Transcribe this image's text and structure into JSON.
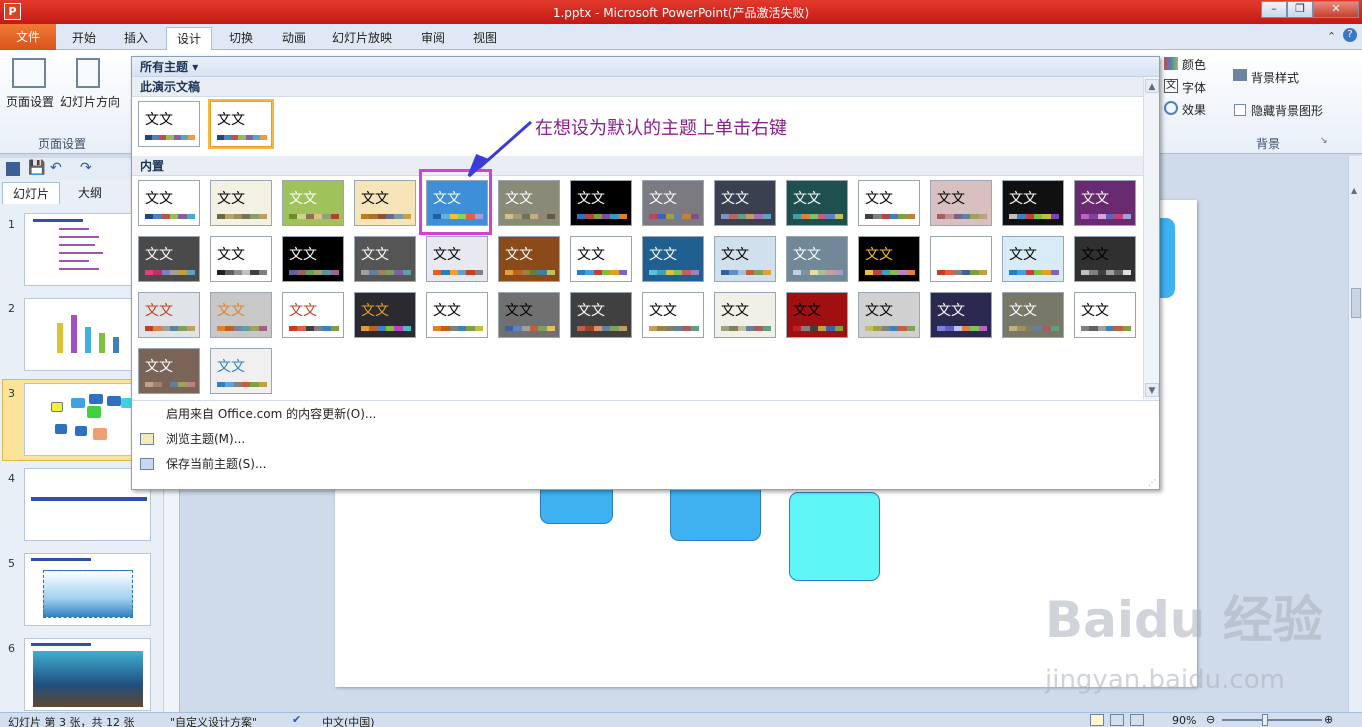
{
  "window": {
    "title": "1.pptx - Microsoft PowerPoint(产品激活失败)",
    "app_icon": "P"
  },
  "tabs": [
    "文件",
    "开始",
    "插入",
    "设计",
    "切换",
    "动画",
    "幻灯片放映",
    "审阅",
    "视图"
  ],
  "active_tab": "设计",
  "ribbon": {
    "page_setup": "页面设置",
    "slide_orientation": "幻灯片方向",
    "group_page_setup": "页面设置",
    "colors": "颜色",
    "fonts": "字体",
    "effects": "效果",
    "background_styles": "背景样式",
    "hide_background": "隐藏背景图形",
    "group_background": "背景"
  },
  "left_panel": {
    "tabs": [
      "幻灯片",
      "大纲"
    ],
    "slide_numbers": [
      "1",
      "2",
      "3",
      "4",
      "5",
      "6"
    ]
  },
  "gallery": {
    "header": "所有主题",
    "section_this": "此演示文稿",
    "section_builtin": "内置",
    "theme_text": "文文",
    "menu": [
      {
        "icon": "",
        "label": "启用来自 Office.com 的内容更新(O)..."
      },
      {
        "icon": "browse-icon",
        "label": "浏览主题(M)..."
      },
      {
        "icon": "save-icon",
        "label": "保存当前主题(S)..."
      }
    ],
    "this_themes": [
      {
        "bg": "#ffffff",
        "fg": "#000000",
        "sw": [
          "#1f497d",
          "#4f81bd",
          "#c0504d",
          "#9bbb59",
          "#8064a2",
          "#4bacc6",
          "#f79646"
        ]
      },
      {
        "bg": "#ffffff",
        "fg": "#000000",
        "sw": [
          "#1f497d",
          "#4f81bd",
          "#c0504d",
          "#9bbb59",
          "#8064a2",
          "#4bacc6",
          "#f79646"
        ],
        "selected": true
      }
    ],
    "builtin": [
      {
        "bg": "#ffffff",
        "fg": "#000",
        "sw": [
          "#1f497d",
          "#4f81bd",
          "#c0504d",
          "#9bbb59",
          "#8064a2",
          "#4bacc6"
        ]
      },
      {
        "bg": "#f3f0e4",
        "fg": "#000",
        "sw": [
          "#6b6b40",
          "#b5a46b",
          "#9c8e5f",
          "#7c6f5a",
          "#8a9b6d",
          "#c29f5f"
        ]
      },
      {
        "bg": "#9fc35a",
        "fg": "#ffffff",
        "sw": [
          "#6e8b2f",
          "#c5d88a",
          "#8d6f5a",
          "#e0c080",
          "#90a070",
          "#b04030"
        ]
      },
      {
        "bg": "#f7e4b8",
        "fg": "#000",
        "sw": [
          "#c07a20",
          "#a87030",
          "#905030",
          "#6a6a8a",
          "#7a9aa0",
          "#c5a050"
        ]
      },
      {
        "bg": "#3d8fd8",
        "fg": "#ffffff",
        "sw": [
          "#1f5fa0",
          "#60b0e0",
          "#f0c040",
          "#90d060",
          "#e06040",
          "#a0a0e0"
        ],
        "highlight": true
      },
      {
        "bg": "#8a8a78",
        "fg": "#ffffff",
        "sw": [
          "#d0c090",
          "#a0a070",
          "#707060",
          "#c0b080",
          "#908870",
          "#605848"
        ]
      },
      {
        "bg": "#000000",
        "fg": "#ffffff",
        "sw": [
          "#3070c0",
          "#c04040",
          "#80a030",
          "#8050a0",
          "#30a0c0",
          "#e08020"
        ]
      },
      {
        "bg": "#7a7a80",
        "fg": "#ffffff",
        "sw": [
          "#c04060",
          "#4060c0",
          "#a0a040",
          "#6080a0",
          "#c08040",
          "#805080"
        ]
      },
      {
        "bg": "#3a4050",
        "fg": "#ffffff",
        "sw": [
          "#8090c0",
          "#c06060",
          "#60a080",
          "#c0a060",
          "#a070b0",
          "#60a0c0"
        ]
      },
      {
        "bg": "#1e5050",
        "fg": "#ffffff",
        "sw": [
          "#40a0a0",
          "#e08040",
          "#80c060",
          "#c06080",
          "#6080c0",
          "#c0c060"
        ]
      },
      {
        "bg": "#ffffff",
        "fg": "#000",
        "sw": [
          "#404040",
          "#808080",
          "#c04040",
          "#4080c0",
          "#80a040",
          "#c08040"
        ]
      },
      {
        "bg": "#d8c0c0",
        "fg": "#000",
        "sw": [
          "#a06060",
          "#c09090",
          "#806080",
          "#6080a0",
          "#a0a060",
          "#c0a080"
        ]
      },
      {
        "bg": "#101010",
        "fg": "#ffffff",
        "sw": [
          "#c0c0c0",
          "#4080c0",
          "#c04040",
          "#80c040",
          "#c0c040",
          "#8040c0"
        ]
      },
      {
        "bg": "#6a2a70",
        "fg": "#ffffff",
        "sw": [
          "#c060c0",
          "#8040a0",
          "#e0a0e0",
          "#6060c0",
          "#c04080",
          "#a0a0e0"
        ]
      },
      {
        "bg": "#4a4a4a",
        "fg": "#ffffff",
        "sw": [
          "#e04080",
          "#c03060",
          "#8080c0",
          "#a0a0a0",
          "#c0a040",
          "#60a0c0"
        ]
      },
      {
        "bg": "#ffffff",
        "fg": "#000",
        "sw": [
          "#202020",
          "#606060",
          "#909090",
          "#c0c0c0",
          "#404040",
          "#808080"
        ]
      },
      {
        "bg": "#000000",
        "fg": "#ffffff",
        "sw": [
          "#6060a0",
          "#a06060",
          "#60a060",
          "#a0a060",
          "#6090a0",
          "#a06090"
        ]
      },
      {
        "bg": "#555555",
        "fg": "#ffffff",
        "sw": [
          "#a0a0a0",
          "#6080a0",
          "#a08060",
          "#80a060",
          "#8060a0",
          "#60a0a0"
        ]
      },
      {
        "bg": "#e8e8f0",
        "fg": "#000",
        "sw": [
          "#e06020",
          "#2080c0",
          "#f0a030",
          "#60a0d0",
          "#c04020",
          "#808080"
        ]
      },
      {
        "bg": "#8a4a1a",
        "fg": "#ffffff",
        "sw": [
          "#e0a040",
          "#c06020",
          "#a08040",
          "#608040",
          "#4080a0",
          "#c0c060"
        ]
      },
      {
        "bg": "#ffffff",
        "fg": "#000",
        "sw": [
          "#2080c0",
          "#40a0e0",
          "#c04040",
          "#80c040",
          "#e0a020",
          "#8060c0"
        ]
      },
      {
        "bg": "#206090",
        "fg": "#ffffff",
        "sw": [
          "#60c0e0",
          "#40a0c0",
          "#e0c040",
          "#80c060",
          "#c06060",
          "#a080c0"
        ]
      },
      {
        "bg": "#d0e0ec",
        "fg": "#000",
        "sw": [
          "#3060a0",
          "#6090c0",
          "#a0c0e0",
          "#c06040",
          "#80a060",
          "#e0a040"
        ]
      },
      {
        "bg": "#708898",
        "fg": "#ffffff",
        "sw": [
          "#c0d0e0",
          "#8090a0",
          "#e0e0a0",
          "#a0c0a0",
          "#c0a0a0",
          "#a0a0c0"
        ]
      },
      {
        "bg": "#000000",
        "fg": "#f0c040",
        "sw": [
          "#f0c040",
          "#c04040",
          "#40a0c0",
          "#80c040",
          "#c080c0",
          "#e08040"
        ]
      },
      {
        "bg": "#ffffff",
        "fg": "#ffffff",
        "sw": [
          "#c04020",
          "#e06040",
          "#808080",
          "#4060a0",
          "#80a040",
          "#c0a040"
        ]
      },
      {
        "bg": "#d8ecf8",
        "fg": "#000",
        "sw": [
          "#2080c0",
          "#40a0e0",
          "#c04040",
          "#80c040",
          "#e0a020",
          "#8060c0"
        ]
      },
      {
        "bg": "#303030",
        "fg": "#000",
        "sw": [
          "#c0c0c0",
          "#808080",
          "#404040",
          "#a0a0a0",
          "#606060",
          "#e0e0e0"
        ]
      },
      {
        "bg": "#e0e4e8",
        "fg": "#c04020",
        "sw": [
          "#c04020",
          "#e08040",
          "#a0a0a0",
          "#6080a0",
          "#80a060",
          "#c0a060"
        ]
      },
      {
        "bg": "#c8c8c8",
        "fg": "#e08030",
        "sw": [
          "#e08030",
          "#c06020",
          "#8080a0",
          "#60a0a0",
          "#a0a060",
          "#a06080"
        ]
      },
      {
        "bg": "#ffffff",
        "fg": "#c04020",
        "sw": [
          "#c04020",
          "#e06040",
          "#404040",
          "#808080",
          "#4080c0",
          "#80a040"
        ]
      },
      {
        "bg": "#2a2a30",
        "fg": "#e0a030",
        "sw": [
          "#e0a030",
          "#c06020",
          "#4080c0",
          "#80c040",
          "#c040c0",
          "#40c0c0"
        ]
      },
      {
        "bg": "#ffffff",
        "fg": "#000",
        "sw": [
          "#e08020",
          "#c06010",
          "#808080",
          "#4080c0",
          "#80a040",
          "#c0c040"
        ]
      },
      {
        "bg": "#707070",
        "fg": "#000",
        "sw": [
          "#4060a0",
          "#6080c0",
          "#a0a0a0",
          "#c06040",
          "#80a060",
          "#e0c060"
        ]
      },
      {
        "bg": "#404040",
        "fg": "#ffffff",
        "sw": [
          "#c06040",
          "#a04020",
          "#e09060",
          "#6080a0",
          "#80a060",
          "#c0a060"
        ]
      },
      {
        "bg": "#ffffff",
        "fg": "#000",
        "sw": [
          "#c0a060",
          "#a08040",
          "#808060",
          "#6080a0",
          "#a06060",
          "#60a080"
        ]
      },
      {
        "bg": "#f0f0e8",
        "fg": "#000",
        "sw": [
          "#a0a080",
          "#808060",
          "#c0c0a0",
          "#6080a0",
          "#a06060",
          "#60a080"
        ]
      },
      {
        "bg": "#a01010",
        "fg": "#000",
        "sw": [
          "#c02020",
          "#808080",
          "#404040",
          "#c0a040",
          "#4060a0",
          "#80a040"
        ]
      },
      {
        "bg": "#d0d0d0",
        "fg": "#000",
        "sw": [
          "#c0c060",
          "#a0a040",
          "#808080",
          "#4080c0",
          "#c06040",
          "#80a060"
        ]
      },
      {
        "bg": "#2a2a50",
        "fg": "#ffffff",
        "sw": [
          "#8080e0",
          "#6060c0",
          "#c0c0ff",
          "#e08040",
          "#80c060",
          "#c060c0"
        ]
      },
      {
        "bg": "#787868",
        "fg": "#ffffff",
        "sw": [
          "#c0b080",
          "#a09060",
          "#808060",
          "#6080a0",
          "#a06060",
          "#60a080"
        ]
      },
      {
        "bg": "#ffffff",
        "fg": "#000",
        "sw": [
          "#808080",
          "#606060",
          "#a0a0a0",
          "#4080c0",
          "#c06040",
          "#80a040"
        ]
      },
      {
        "bg": "#7a6458",
        "fg": "#ffffff",
        "sw": [
          "#c0a090",
          "#a08070",
          "#806050",
          "#6080a0",
          "#a0a060",
          "#c08080"
        ]
      },
      {
        "bg": "#f0f0f0",
        "fg": "#3080c0",
        "sw": [
          "#3080c0",
          "#60a0e0",
          "#808080",
          "#c06040",
          "#80a040",
          "#c0a040"
        ]
      }
    ]
  },
  "annotation": "在想设为默认的主题上单击右键",
  "statusbar": {
    "slide_info": "幻灯片 第 3 张，共 12 张",
    "theme_name": "\"自定义设计方案\"",
    "language": "中文(中国)",
    "zoom": "90%"
  },
  "watermark": {
    "brand": "Baidu 经验",
    "url": "jingyan.baidu.com"
  }
}
